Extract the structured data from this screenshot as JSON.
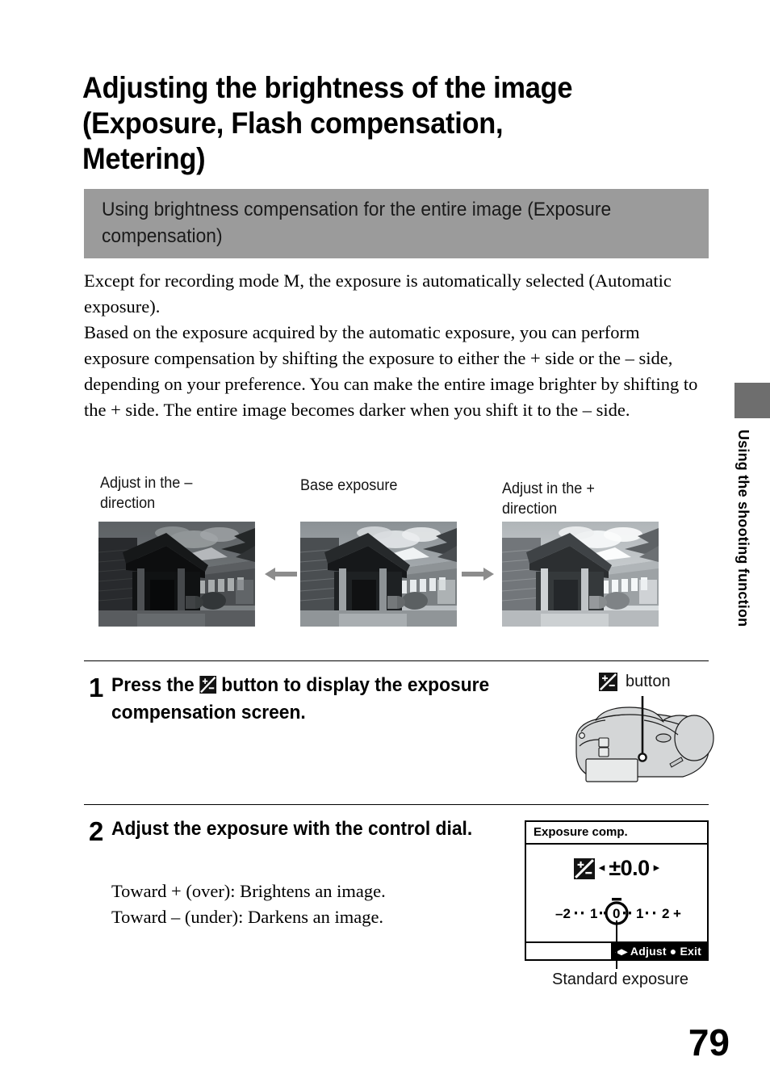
{
  "page": {
    "number": "79",
    "edge_tab_label": "Using the shooting function"
  },
  "heading": {
    "title": "Adjusting the brightness of the image (Exposure, Flash compensation, Metering)",
    "subhead": "Using brightness compensation for the entire image (Exposure compensation)"
  },
  "body": {
    "para1": "Except for recording mode M, the exposure is automatically selected (Automatic exposure).",
    "para2": "Based on the exposure acquired by the automatic exposure, you can perform exposure compensation by shifting the exposure to either the + side or the – side, depending on your preference. You can make the entire image brighter by shifting to the + side. The entire image becomes darker when you shift it to the – side."
  },
  "figure": {
    "caption_minus": "Adjust in the –\ndirection",
    "caption_base": "Base exposure",
    "caption_plus": "Adjust in the +\ndirection",
    "arrow_left_icon": "arrow-left-icon",
    "arrow_right_icon": "arrow-right-icon",
    "photo_minus_alt": "darker exposure photo",
    "photo_base_alt": "base exposure photo",
    "photo_plus_alt": "brighter exposure photo"
  },
  "steps": [
    {
      "number": "1",
      "text_before_icon": "Press the",
      "icon": "exposure-compensation-icon",
      "text_after_icon": "button to display the exposure compensation screen."
    },
    {
      "number": "2",
      "text": "Adjust the exposure with the control dial.",
      "sub1": "Toward + (over): Brightens an image.",
      "sub2": "Toward – (under): Darkens an image."
    }
  ],
  "callout": {
    "icon": "exposure-compensation-icon",
    "label": "button",
    "camera_illustration": "camera-top-view-illustration"
  },
  "lcd": {
    "title": "Exposure comp.",
    "icon": "exposure-compensation-icon",
    "left_triangle": "◂",
    "value": "±0.0",
    "right_triangle": "▸",
    "scale_labels": [
      "–2",
      "1",
      "0",
      "1",
      "2",
      "+"
    ],
    "scale_index_value": "0",
    "bottom_bar": "◂▸ Adjust  ● Exit",
    "caption": "Standard exposure"
  },
  "colors": {
    "subhead_bg": "#9b9b9b",
    "edge_tab": "#6e6e6e",
    "arrow": "#8c8c8c",
    "text": "#000000"
  }
}
